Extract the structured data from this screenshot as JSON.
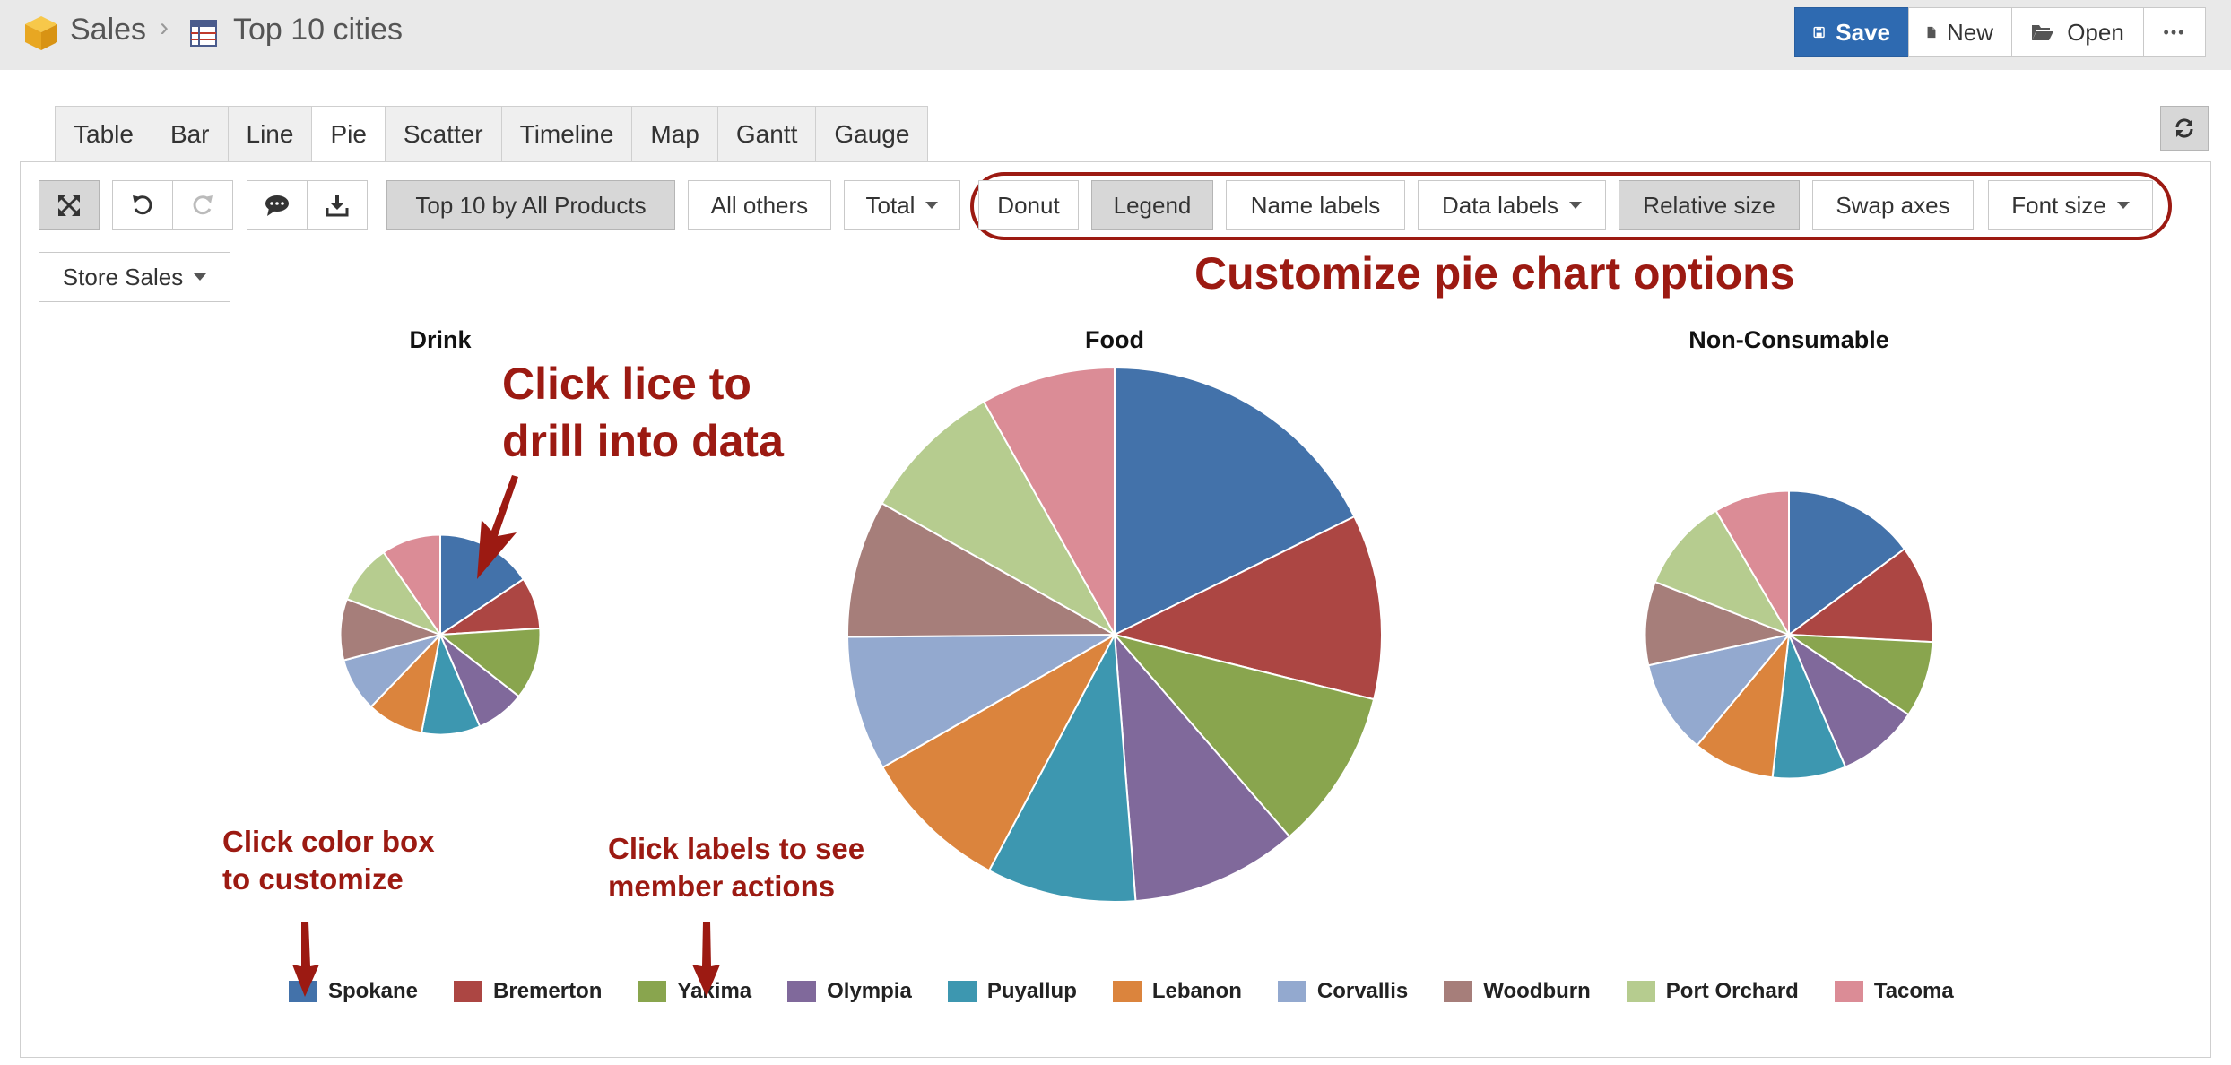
{
  "header": {
    "crumb_root": "Sales",
    "crumb_separator": "›",
    "crumb_report": "Top 10 cities",
    "save_label": "Save",
    "new_label": "New",
    "open_label": "Open",
    "more_label": "•••"
  },
  "tabs": [
    {
      "label": "Table"
    },
    {
      "label": "Bar"
    },
    {
      "label": "Line"
    },
    {
      "label": "Pie"
    },
    {
      "label": "Scatter"
    },
    {
      "label": "Timeline"
    },
    {
      "label": "Map"
    },
    {
      "label": "Gantt"
    },
    {
      "label": "Gauge"
    }
  ],
  "active_tab": "Pie",
  "toolbar": {
    "top_filter": "Top 10 by All Products",
    "all_others": "All others",
    "total": "Total",
    "donut": "Donut",
    "legend": "Legend",
    "name_labels": "Name labels",
    "data_labels": "Data labels",
    "relative_size": "Relative size",
    "swap_axes": "Swap axes",
    "font_size": "Font size",
    "measure": "Store Sales"
  },
  "annotations": {
    "options": "Customize pie chart options",
    "slice_line1": "Click lice to",
    "slice_line2": "drill into data",
    "color_line1": "Click color box",
    "color_line2": "to customize",
    "labels_line1": "Click labels to see",
    "labels_line2": "member actions",
    "annotation_color": "#9c1a12"
  },
  "chart_data": {
    "type": "pie",
    "categories": [
      "Spokane",
      "Bremerton",
      "Yakima",
      "Olympia",
      "Puyallup",
      "Lebanon",
      "Corvallis",
      "Woodburn",
      "Port Orchard",
      "Tacoma"
    ],
    "colors": [
      "#4372aa",
      "#ac4643",
      "#89a54e",
      "#80699b",
      "#3d97b0",
      "#db843d",
      "#93a9cf",
      "#a67e7a",
      "#b6cc8f",
      "#db8c96"
    ],
    "relative_size": true,
    "legend_position": "bottom",
    "series": [
      {
        "name": "Drink",
        "values": [
          14.0,
          7.5,
          10.4,
          7.1,
          8.5,
          8.2,
          7.8,
          8.9,
          8.6,
          8.6
        ],
        "total_relative": 0.14
      },
      {
        "name": "Food",
        "values": [
          19.8,
          12.5,
          10.9,
          11.3,
          10.1,
          10.0,
          9.1,
          9.3,
          9.7,
          9.1
        ],
        "total_relative": 1.0
      },
      {
        "name": "Non-Consumable",
        "values": [
          14.2,
          10.5,
          8.2,
          8.8,
          7.9,
          8.8,
          10.1,
          9.0,
          10.1,
          8.1
        ],
        "total_relative": 0.29
      }
    ]
  }
}
